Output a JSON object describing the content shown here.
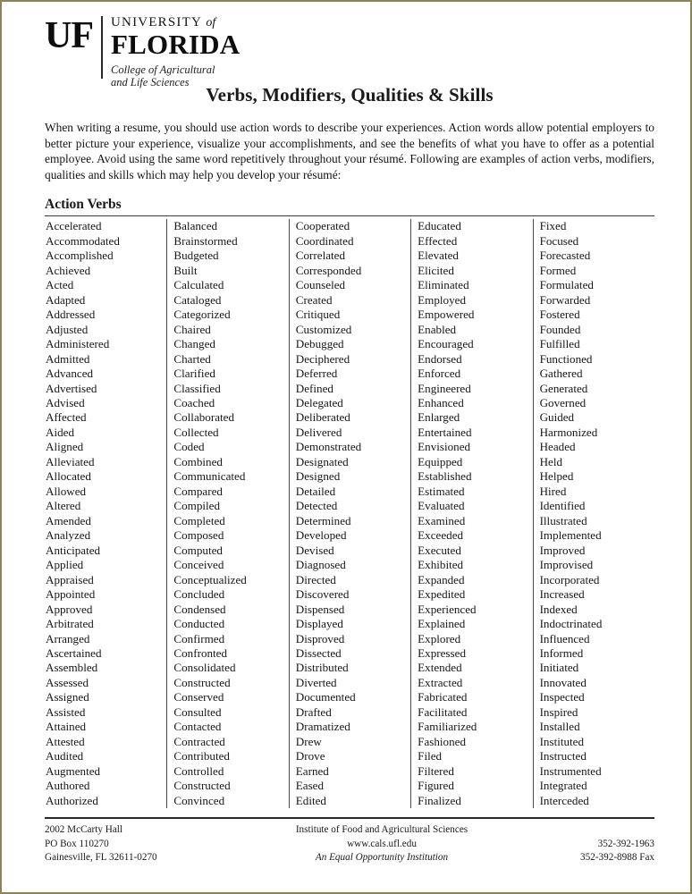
{
  "logo": {
    "uf_mark": "UF",
    "university_line": "UNIVERSITY",
    "university_of": "of",
    "florida_line": "FLORIDA",
    "college_line1": "College of Agricultural",
    "college_line2": "and Life Sciences"
  },
  "title": "Verbs, Modifiers, Qualities & Skills",
  "intro": "When writing a resume, you should use action words to describe your experiences. Action words allow potential employers to better picture your experience, visualize your accomplishments, and see the benefits of what you have to offer as a potential employee. Avoid using the same word repetitively throughout your résumé. Following are examples of action verbs, modifiers, qualities and skills which may help you develop your résumé:",
  "section_title": "Action Verbs",
  "columns": [
    [
      "Accelerated",
      "Accommodated",
      "Accomplished",
      "Achieved",
      "Acted",
      "Adapted",
      "Addressed",
      "Adjusted",
      "Administered",
      "Admitted",
      "Advanced",
      "Advertised",
      "Advised",
      "Affected",
      "Aided",
      "Aligned",
      "Alleviated",
      "Allocated",
      "Allowed",
      "Altered",
      "Amended",
      "Analyzed",
      "Anticipated",
      "Applied",
      "Appraised",
      "Appointed",
      "Approved",
      "Arbitrated",
      "Arranged",
      "Ascertained",
      "Assembled",
      "Assessed",
      "Assigned",
      "Assisted",
      "Attained",
      "Attested",
      "Audited",
      "Augmented",
      "Authored",
      "Authorized"
    ],
    [
      "Balanced",
      "Brainstormed",
      "Budgeted",
      "Built",
      "Calculated",
      "Cataloged",
      "Categorized",
      "Chaired",
      "Changed",
      "Charted",
      "Clarified",
      "Classified",
      "Coached",
      "Collaborated",
      "Collected",
      "Coded",
      "Combined",
      "Communicated",
      "Compared",
      "Compiled",
      "Completed",
      "Composed",
      "Computed",
      "Conceived",
      "Conceptualized",
      "Concluded",
      "Condensed",
      "Conducted",
      "Confirmed",
      "Confronted",
      "Consolidated",
      "Constructed",
      "Conserved",
      "Consulted",
      "Contacted",
      "Contracted",
      "Contributed",
      "Controlled",
      "Constructed",
      "Convinced"
    ],
    [
      "Cooperated",
      "Coordinated",
      "Correlated",
      "Corresponded",
      "Counseled",
      "Created",
      "Critiqued",
      "Customized",
      "Debugged",
      "Deciphered",
      "Deferred",
      "Defined",
      "Delegated",
      "Deliberated",
      "Delivered",
      "Demonstrated",
      "Designated",
      "Designed",
      "Detailed",
      "Detected",
      "Determined",
      "Developed",
      "Devised",
      "Diagnosed",
      "Directed",
      "Discovered",
      "Dispensed",
      "Displayed",
      "Disproved",
      "Dissected",
      "Distributed",
      "Diverted",
      "Documented",
      "Drafted",
      "Dramatized",
      "Drew",
      "Drove",
      "Earned",
      "Eased",
      "Edited"
    ],
    [
      "Educated",
      "Effected",
      "Elevated",
      "Elicited",
      "Eliminated",
      "Employed",
      "Empowered",
      "Enabled",
      "Encouraged",
      "Endorsed",
      "Enforced",
      "Engineered",
      "Enhanced",
      "Enlarged",
      "Entertained",
      "Envisioned",
      "Equipped",
      "Established",
      "Estimated",
      "Evaluated",
      "Examined",
      "Exceeded",
      "Executed",
      "Exhibited",
      "Expanded",
      "Expedited",
      "Experienced",
      "Explained",
      "Explored",
      "Expressed",
      "Extended",
      "Extracted",
      "Fabricated",
      "Facilitated",
      "Familiarized",
      "Fashioned",
      "Filed",
      "Filtered",
      "Figured",
      "Finalized"
    ],
    [
      "Fixed",
      "Focused",
      "Forecasted",
      "Formed",
      "Formulated",
      "Forwarded",
      "Fostered",
      "Founded",
      "Fulfilled",
      "Functioned",
      "Gathered",
      "Generated",
      "Governed",
      "Guided",
      "Harmonized",
      "Headed",
      "Held",
      "Helped",
      "Hired",
      "Identified",
      "Illustrated",
      "Implemented",
      "Improved",
      "Improvised",
      "Incorporated",
      "Increased",
      "Indexed",
      "Indoctrinated",
      "Influenced",
      "Informed",
      "Initiated",
      "Innovated",
      "Inspected",
      "Inspired",
      "Installed",
      "Instituted",
      "Instructed",
      "Instrumented",
      "Integrated",
      "Interceded"
    ]
  ],
  "footer": {
    "address_line1": "2002 McCarty Hall",
    "address_line2": "PO Box 110270",
    "address_line3": "Gainesville, FL  32611-0270",
    "center_line1": "Institute of Food and Agricultural Sciences",
    "center_line2": "www.cals.ufl.edu",
    "center_line3": "An Equal Opportunity Institution",
    "right_line1": "",
    "right_line2": "352-392-1963",
    "right_line3": "352-392-8988 Fax"
  }
}
